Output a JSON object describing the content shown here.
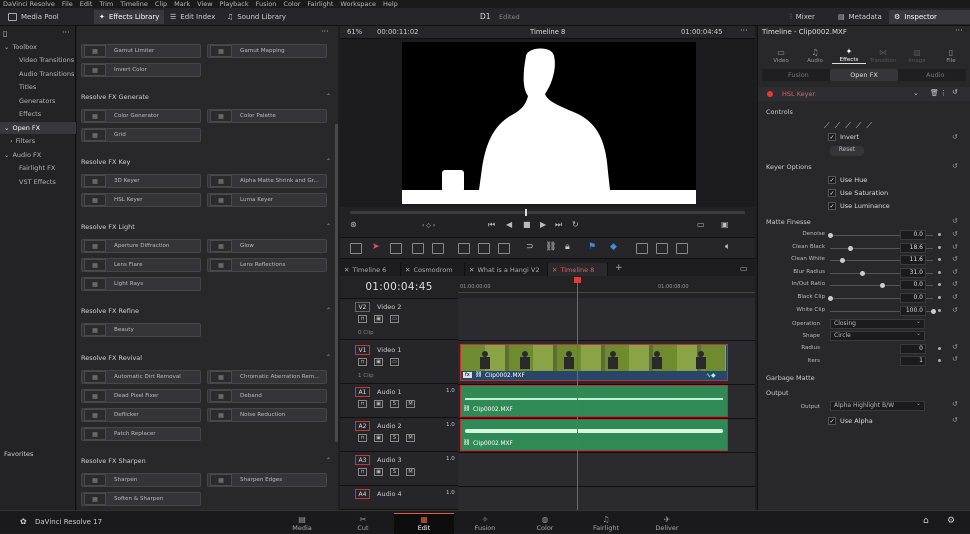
{
  "menu": [
    "DaVinci Resolve",
    "File",
    "Edit",
    "Trim",
    "Timeline",
    "Clip",
    "Mark",
    "View",
    "Playback",
    "Fusion",
    "Color",
    "Fairlight",
    "Workspace",
    "Help"
  ],
  "toolbar": {
    "media_pool": "Media Pool",
    "effects_library": "Effects Library",
    "edit_index": "Edit Index",
    "sound_library": "Sound Library",
    "project": "D1",
    "status": "Edited",
    "mixer": "Mixer",
    "metadata": "Metadata",
    "inspector": "Inspector"
  },
  "left_panel": {
    "items": [
      "Toolbox",
      "Video Transitions",
      "Audio Transitions",
      "Titles",
      "Generators",
      "Effects",
      "Open FX",
      "Filters",
      "Audio FX",
      "Fairlight FX",
      "VST Effects"
    ],
    "favorites": "Favorites"
  },
  "library": {
    "categories": [
      "Resolve FX Generate",
      "Resolve FX Key",
      "Resolve FX Light",
      "Resolve FX Refine",
      "Resolve FX Revival",
      "Resolve FX Sharpen"
    ],
    "top_items": [
      "Gamut Limiter",
      "Gamut Mapping",
      "Invert Color"
    ],
    "generate": [
      "Color Generator",
      "Color Palette",
      "Grid"
    ],
    "key": [
      "3D Keyer",
      "Alpha Matte Shrink and Gr...",
      "HSL Keyer",
      "Luma Keyer"
    ],
    "light": [
      "Aperture Diffraction",
      "Glow",
      "Lens Flare",
      "Lens Reflections",
      "Light Rays"
    ],
    "refine": [
      "Beauty"
    ],
    "revival": [
      "Automatic Dirt Removal",
      "Chromatic Aberration Rem...",
      "Dead Pixel Fixer",
      "Deband",
      "Deflicker",
      "Noise Reduction",
      "Patch Replacer"
    ],
    "sharpen": [
      "Sharpen",
      "Sharpen Edges",
      "Soften & Sharpen"
    ]
  },
  "viewer": {
    "zoom": "61%",
    "timecode": "00:00:11:02",
    "timeline_name": "Timeline 8",
    "current_tc": "01:00:04:45"
  },
  "timeline": {
    "tabs": [
      "Timeline 6",
      "Cosmodrom",
      "What is a Hangi V2",
      "Timeline 8"
    ],
    "timecode": "01:00:04:45",
    "ruler": [
      "01:00:00:00",
      "01:00:08:00"
    ],
    "tracks": [
      {
        "tag": "V2",
        "name": "Video 2",
        "sub": "0 Clip"
      },
      {
        "tag": "V1",
        "name": "Video 1",
        "sub": "1 Clip"
      },
      {
        "tag": "A1",
        "name": "Audio 1",
        "level": "1.0"
      },
      {
        "tag": "A2",
        "name": "Audio 2",
        "level": "1.0"
      },
      {
        "tag": "A3",
        "name": "Audio 3",
        "level": "1.0"
      },
      {
        "tag": "A4",
        "name": "Audio 4",
        "level": "1.0"
      }
    ],
    "video_clip": "Clip0002.MXF",
    "audio_clip_1": "Clip0002.MXF",
    "audio_clip_2": "Clip0002.MXF",
    "fx_badge": "fx",
    "solo": "S",
    "mute": "M"
  },
  "inspector": {
    "title": "Timeline - Clip0002.MXF",
    "tabs": [
      "Video",
      "Audio",
      "Effects",
      "Transition",
      "Image",
      "File"
    ],
    "subtabs": [
      "Fusion",
      "Open FX",
      "Audio"
    ],
    "effect_name": "HSL Keyer",
    "controls": "Controls",
    "invert": "Invert",
    "reset": "Reset",
    "keyer_options": "Keyer Options",
    "use_hue": "Use Hue",
    "use_saturation": "Use Saturation",
    "use_luminance": "Use Luminance",
    "matte_finesse": "Matte Finesse",
    "params": [
      {
        "label": "Denoise",
        "value": "0.0",
        "frac": 0.0
      },
      {
        "label": "Clean Black",
        "value": "18.6",
        "frac": 0.19
      },
      {
        "label": "Clean White",
        "value": "11.6",
        "frac": 0.12
      },
      {
        "label": "Blur Radius",
        "value": "31.0",
        "frac": 0.31
      },
      {
        "label": "In/Out Ratio",
        "value": "0.0",
        "frac": 0.5
      },
      {
        "label": "Black Clip",
        "value": "0.0",
        "frac": 0.0
      },
      {
        "label": "White Clip",
        "value": "100.0",
        "frac": 1.0
      }
    ],
    "operation_label": "Operation",
    "operation": "Closing",
    "shape_label": "Shape",
    "shape": "Circle",
    "radius_label": "Radius",
    "radius": "0",
    "iters_label": "Iters",
    "iters": "1",
    "garbage_matte": "Garbage Matte",
    "output_section": "Output",
    "output_label": "Output",
    "output": "Alpha Highlight B/W",
    "use_alpha": "Use Alpha"
  },
  "pages": [
    "Media",
    "Cut",
    "Edit",
    "Fusion",
    "Color",
    "Fairlight",
    "Deliver"
  ],
  "brand": "DaVinci Resolve 17",
  "accent": "#e05b4b"
}
